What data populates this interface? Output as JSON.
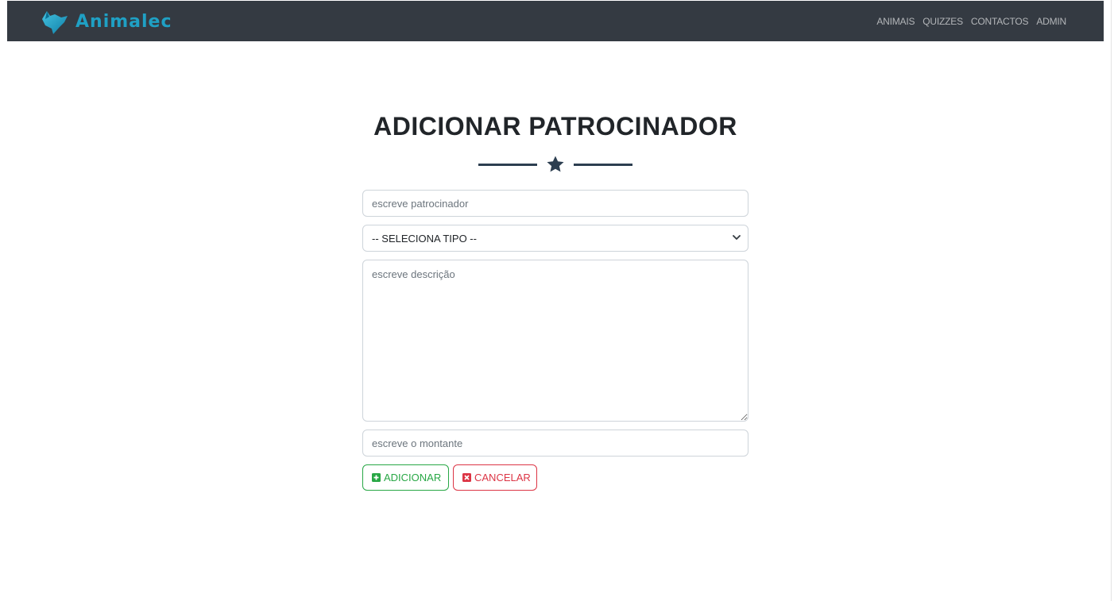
{
  "navbar": {
    "brand": "Animalec",
    "links": [
      "ANIMAIS",
      "QUIZZES",
      "CONTACTOS",
      "ADMIN"
    ]
  },
  "page": {
    "title": "ADICIONAR PATROCINADOR",
    "divider_icon": "star-icon"
  },
  "form": {
    "sponsor_placeholder": "escreve patrocinador",
    "type_select_value": "-- SELECIONA TIPO --",
    "description_placeholder": "escreve descrição",
    "amount_placeholder": "escreve o montante",
    "add_label": "ADICIONAR",
    "cancel_label": "CANCELAR"
  },
  "colors": {
    "navbar_bg": "#343a42",
    "brand": "#1fa0c4",
    "success": "#28a745",
    "danger": "#dc3545",
    "divider": "#2c3e50"
  }
}
